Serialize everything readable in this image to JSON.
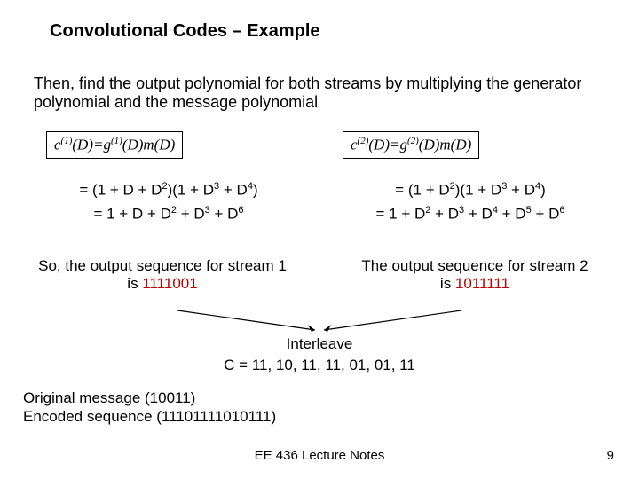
{
  "title": "Convolutional Codes – Example",
  "intro": "Then, find the output polynomial for both streams by multiplying the generator polynomial and the message polynomial",
  "left": {
    "step1_prefix": "= (1 + D + D",
    "step1_mid": ")(1 + D",
    "step1_mid2": " + D",
    "step1_end": ")",
    "step2_prefix": "= 1 + D + D",
    "step2_plus": " + D",
    "out_label_a": "So, the output sequence for stream 1",
    "out_label_b": "is ",
    "out_seq": "1111001"
  },
  "right": {
    "step1_prefix": "= (1 + D",
    "step1_mid": ")(1 + D",
    "step1_mid2": " + D",
    "step1_end": ")",
    "step2_prefix": "= 1 + D",
    "step2_plus": " + D",
    "out_label_a": "The output sequence for stream 2",
    "out_label_b": "is ",
    "out_seq": "1011111"
  },
  "exps": {
    "l1a": "2",
    "l1b": "3",
    "l1c": "4",
    "l2a": "2",
    "l2b": "3",
    "l2c": "6",
    "r1a": "2",
    "r1b": "3",
    "r1c": "4",
    "r2a": "2",
    "r2b": "3",
    "r2c": "4",
    "r2d": "5",
    "r2e": "6"
  },
  "interleave_label": "Interleave",
  "c_line": "C = 11, 10, 11, 11, 01, 01, 11",
  "orig1": "Original message (10011)",
  "orig2": "Encoded sequence (11101111010111)",
  "footer": "EE 436 Lecture Notes",
  "page": "9",
  "formula_left_sup1": "(1)",
  "formula_left_sup2": "(1)",
  "formula_right_sup1": "(2)",
  "formula_right_sup2": "(2)"
}
